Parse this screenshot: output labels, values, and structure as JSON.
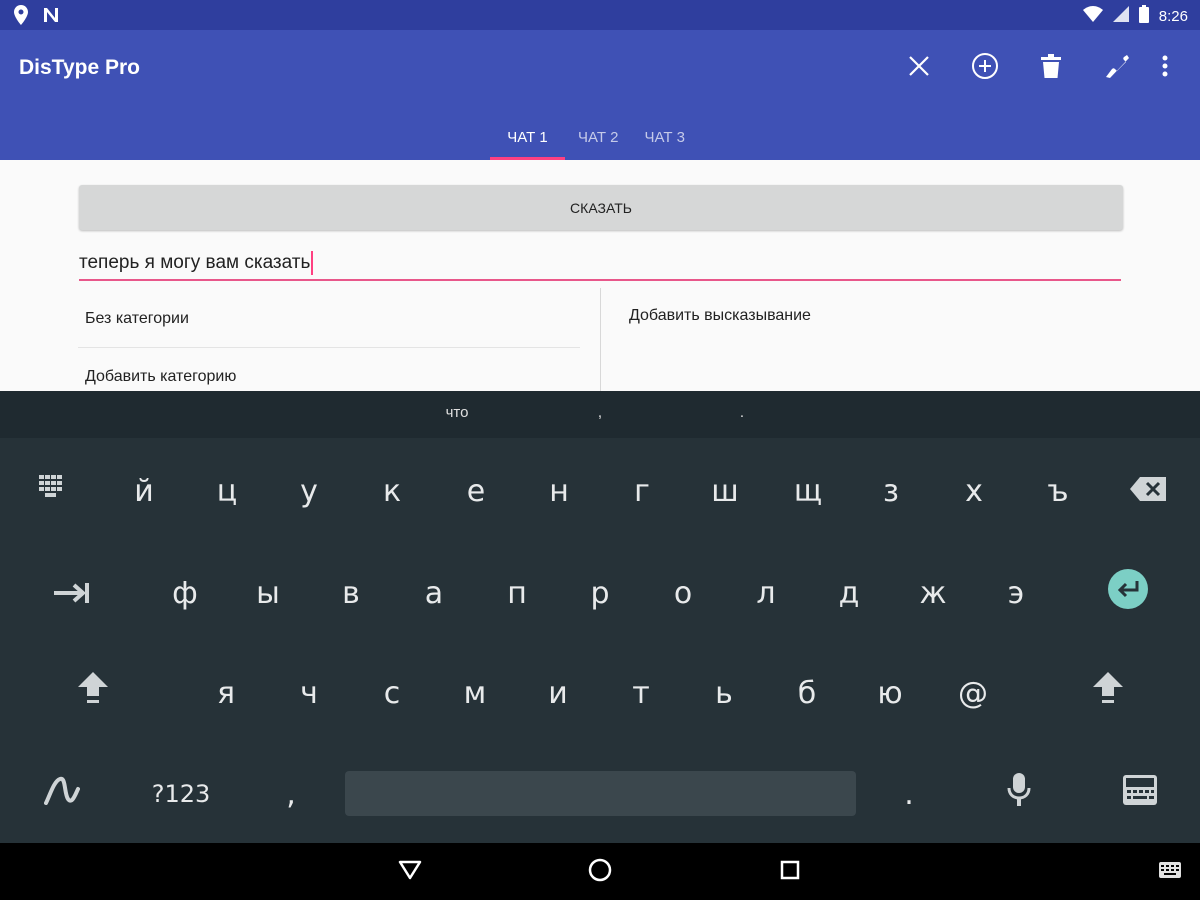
{
  "status_bar": {
    "time": "8:26",
    "icons": [
      "location-icon",
      "n-icon",
      "wifi-icon",
      "signal-icon",
      "battery-icon"
    ]
  },
  "app_bar": {
    "title": "DisType Pro",
    "actions": [
      "close-icon",
      "add-circle-icon",
      "trash-icon",
      "phone-icon",
      "more-vert-icon"
    ]
  },
  "tabs": [
    {
      "label": "ЧАТ 1",
      "active": true
    },
    {
      "label": "ЧАТ 2",
      "active": false
    },
    {
      "label": "ЧАТ 3",
      "active": false
    }
  ],
  "main": {
    "say_button": "СКАЗАТЬ",
    "input_value": "теперь я могу вам сказать",
    "categories": [
      "Без категории",
      "Добавить категорию"
    ],
    "add_phrase": "Добавить высказывание"
  },
  "keyboard": {
    "suggestions": [
      "что",
      ",",
      "."
    ],
    "row1": [
      "й",
      "ц",
      "у",
      "к",
      "е",
      "н",
      "г",
      "ш",
      "щ",
      "з",
      "х",
      "ъ"
    ],
    "row2": [
      "ф",
      "ы",
      "в",
      "а",
      "п",
      "р",
      "о",
      "л",
      "д",
      "ж",
      "э"
    ],
    "row3": [
      "я",
      "ч",
      "с",
      "м",
      "и",
      "т",
      "ь",
      "б",
      "ю",
      "@"
    ],
    "symbols_label": "?123",
    "comma": ",",
    "period": ".",
    "accent_color": "#7ccfc5"
  },
  "colors": {
    "primary": "#3f51b5",
    "primary_dark": "#2f3e9e",
    "accent": "#ff4081",
    "keyboard_bg": "#263238"
  }
}
